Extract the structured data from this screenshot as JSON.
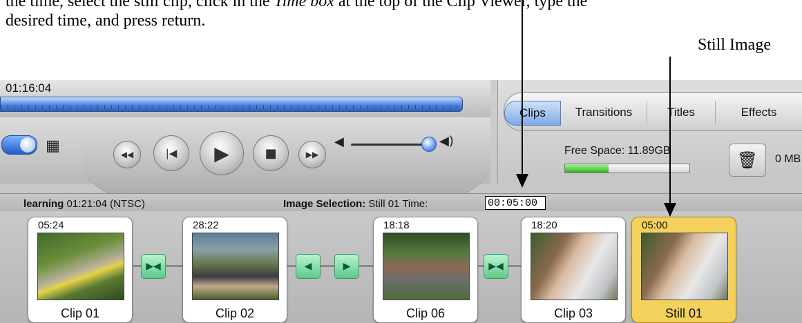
{
  "instructions": {
    "line1_prefix": "the time, select the still clip, click in the ",
    "line1_emphasis": "Time box",
    "line1_suffix": " at the top of the Clip Viewer, type the",
    "line2": "desired time, and press return."
  },
  "annotation": {
    "still_image_label": "Still Image"
  },
  "monitor": {
    "timecode": "01:16:04"
  },
  "tabs": [
    "Clips",
    "Transitions",
    "Titles",
    "Effects"
  ],
  "status": {
    "free_space": "Free Space: 11.89GB",
    "trash_size": "0 MB"
  },
  "clip_viewer": {
    "project_name": "learning",
    "project_info": " 01:21:04 (NTSC)",
    "selection_label": "Image Selection:",
    "selection_value": " Still 01  Time:",
    "time_value": "00:05:00"
  },
  "clips": [
    {
      "duration": "05:24",
      "name": "Clip 01"
    },
    {
      "duration": "28:22",
      "name": "Clip 02"
    },
    {
      "duration": "18:18",
      "name": "Clip 06"
    },
    {
      "duration": "18:20",
      "name": "Clip 03"
    },
    {
      "duration": "05:00",
      "name": "Still 01"
    }
  ],
  "icons": {
    "rewind": "◀◀",
    "previous": "|◀",
    "play": "▶",
    "stop": "■",
    "fast_forward": "▶▶",
    "volume_low": "◀",
    "volume_high": "◀)",
    "trash": "🗑",
    "film": "▦",
    "transition_cross": "▶◀",
    "transition_in": "◀",
    "transition_out": "▶"
  },
  "colors": {
    "accent_blue": "#4d86e0",
    "selected_clip": "#f3d15a",
    "transition_green": "#5ec98b",
    "meter_green": "#35b41f"
  },
  "free_space_meter_fraction": 0.35
}
